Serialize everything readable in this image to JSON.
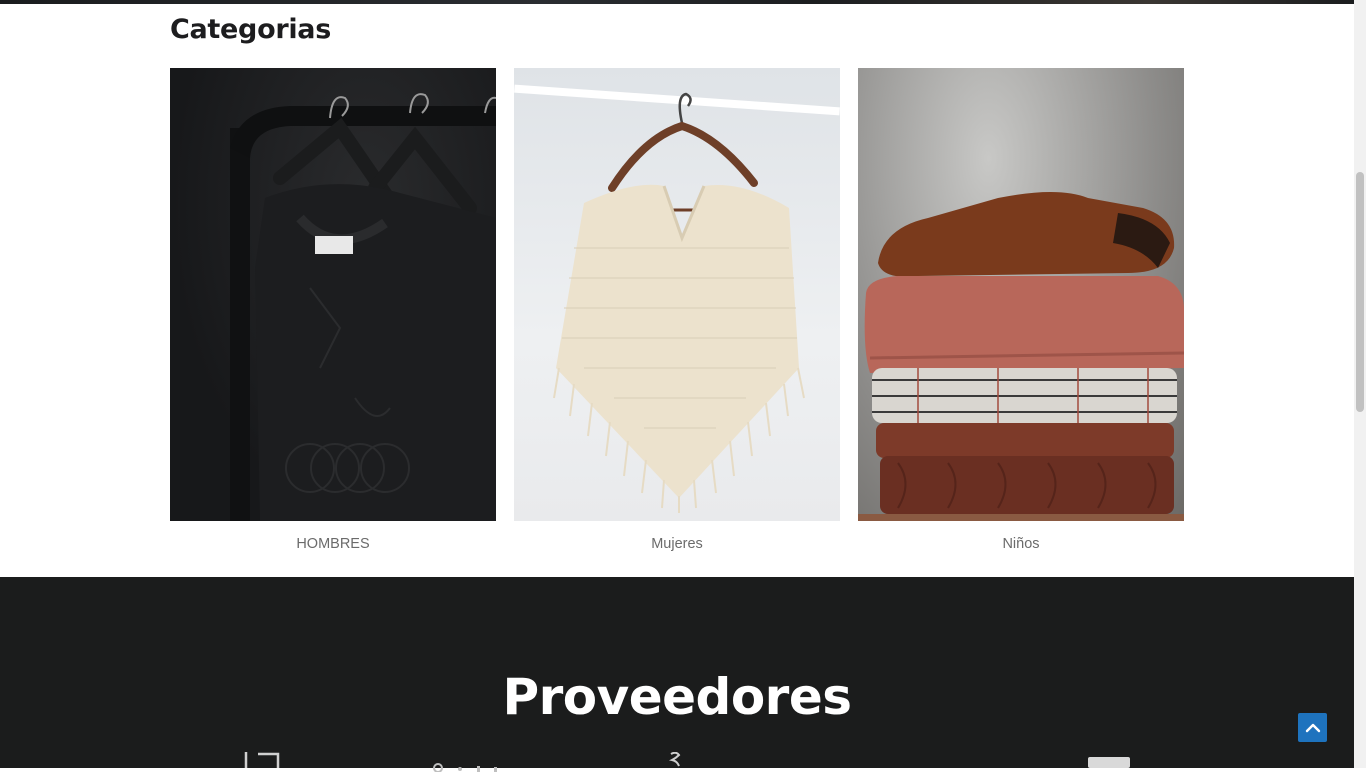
{
  "categories": {
    "title": "Categorias",
    "items": [
      {
        "label": "HOMBRES"
      },
      {
        "label": "Mujeres"
      },
      {
        "label": "Niños"
      }
    ]
  },
  "providers": {
    "title": "Proveedores"
  },
  "colors": {
    "footer_bg": "#1b1c1c",
    "accent": "#1e73be",
    "label_text": "#6b6b6b"
  },
  "icons": {
    "scroll_top": "chevron-up-icon"
  }
}
